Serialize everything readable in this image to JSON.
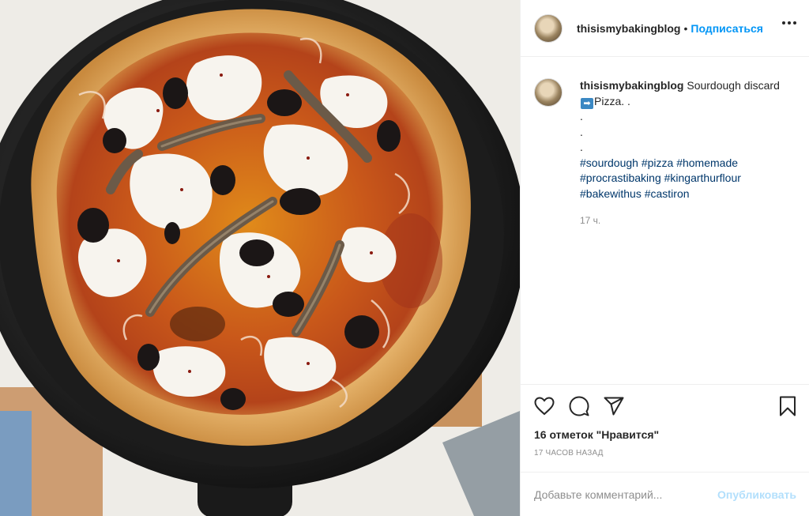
{
  "post": {
    "image_alt": "Sourdough pizza in a cast iron skillet",
    "author": {
      "username": "thisismybakingblog",
      "avatar_icon": "user-avatar"
    },
    "follow_label": "Подписаться",
    "more_icon": "more-dots-icon",
    "caption": {
      "username": "thisismybakingblog",
      "text_before": "Sourdough discard",
      "arrow_glyph": "➡",
      "text_after": "Pizza. .",
      "dots": [
        ".",
        ".",
        "."
      ],
      "hashtags": "#sourdough #pizza #homemade #procrastibaking #kingarthurflour #bakewithus #castiron",
      "time": "17 ч."
    },
    "actions": {
      "like_icon": "heart-icon",
      "comment_icon": "comment-icon",
      "share_icon": "paper-plane-icon",
      "save_icon": "bookmark-icon"
    },
    "likes_text": "16 отметок \"Нравится\"",
    "posted_ago": "17 ЧАСОВ НАЗАД",
    "comment_placeholder": "Добавьте комментарий...",
    "publish_label": "Опубликовать"
  },
  "colors": {
    "link_blue": "#0095f6",
    "hashtag_blue": "#00376b",
    "publish_disabled": "#b2dffc",
    "muted": "#8e8e8e"
  }
}
